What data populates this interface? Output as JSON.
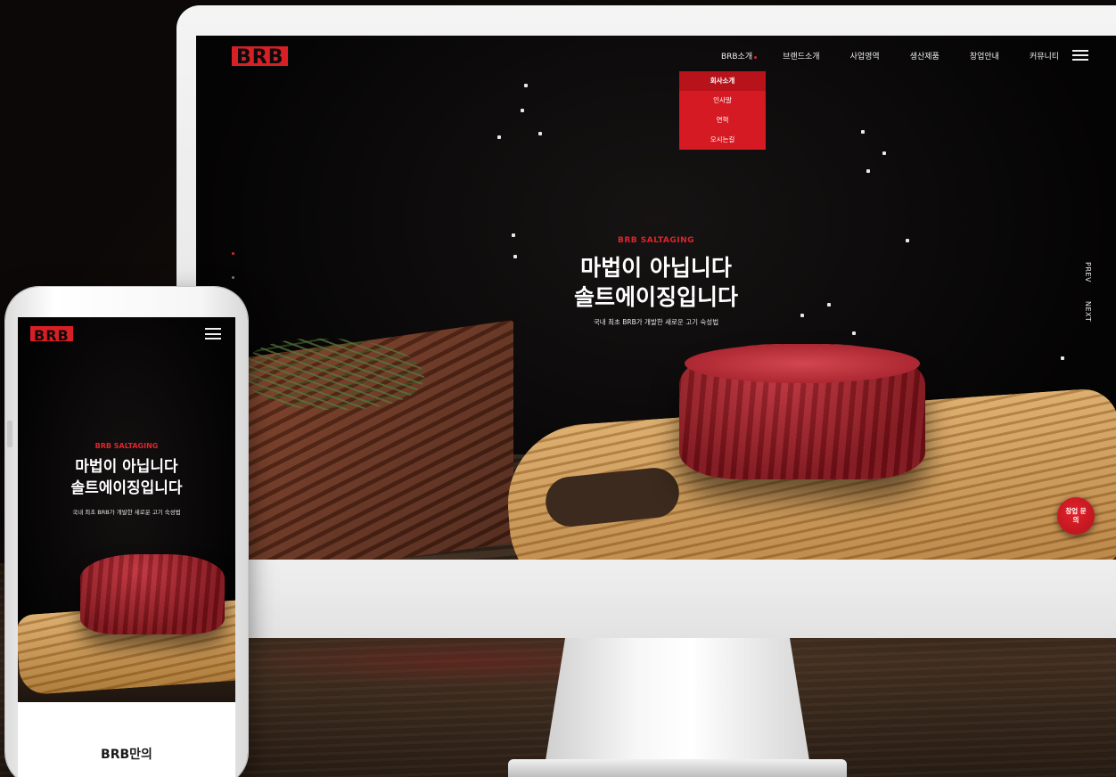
{
  "brand": {
    "logo_text": "BRB",
    "accent": "#d81f26"
  },
  "desktop": {
    "nav": [
      {
        "label": "BRB소개",
        "active": true
      },
      {
        "label": "브랜드소개"
      },
      {
        "label": "사업영역"
      },
      {
        "label": "생산제품"
      },
      {
        "label": "창업안내"
      },
      {
        "label": "커뮤니티"
      }
    ],
    "menu_icon": "hamburger-icon",
    "dropdown": [
      "회사소개",
      "인사말",
      "연혁",
      "오시는길"
    ],
    "hero": {
      "eyebrow": "BRB SALTAGING",
      "title_line1": "마법이 아닙니다",
      "title_line2": "솔트에이징입니다",
      "subtitle": "국내 최초 BRB가 개발한 새로운 고기 숙성법"
    },
    "slider": {
      "prev": "PREV",
      "next": "NEXT"
    },
    "inquiry_button": "창업 문의"
  },
  "mobile": {
    "menu_icon": "hamburger-icon",
    "hero": {
      "eyebrow": "BRB SALTAGING",
      "title_line1": "마법이 아닙니다",
      "title_line2": "솔트에이징입니다",
      "subtitle": "국내 최초 BRB가 개발한 새로운 고기 숙성법"
    },
    "section_title": "BRB만의"
  }
}
